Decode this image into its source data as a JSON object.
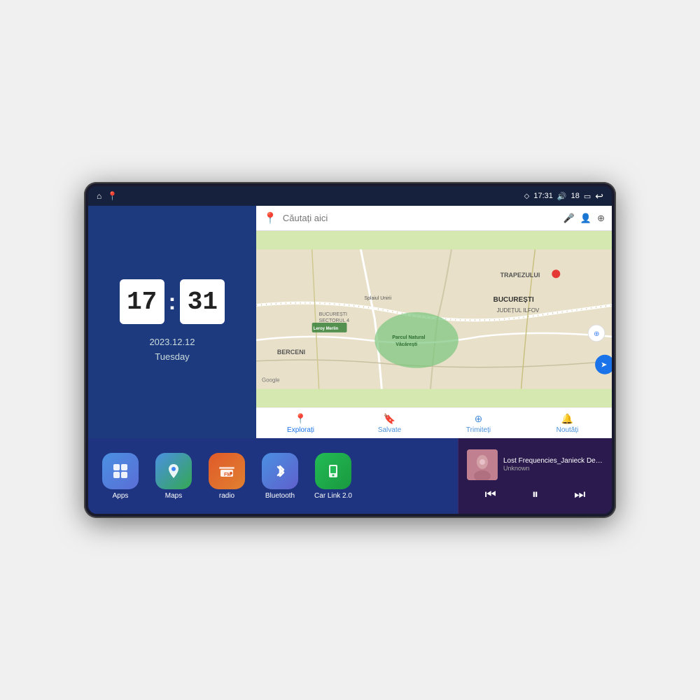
{
  "device": {
    "screen": {
      "status_bar": {
        "left_icons": [
          "home",
          "location"
        ],
        "time": "17:31",
        "volume_icon": "🔊",
        "battery_level": "18",
        "battery_icon": "🔋",
        "back_icon": "↩"
      },
      "clock": {
        "hours": "17",
        "minutes": "31",
        "date": "2023.12.12",
        "day": "Tuesday"
      },
      "map": {
        "search_placeholder": "Căutați aici",
        "location_label": "TRAPEZULUI",
        "city_label": "BUCUREȘTI",
        "region_label": "JUDEȚUL ILFOV",
        "area_label": "BERCENI",
        "park_label": "Parcul Natural Văcărești",
        "store_label": "Leroy Merlin",
        "district_label": "BUCUREȘTI SECTORUL 4",
        "road_label": "Splaiul Unirii",
        "google_label": "Google",
        "nav_items": [
          {
            "label": "Explorați",
            "icon": "📍",
            "active": true
          },
          {
            "label": "Salvate",
            "icon": "🔖",
            "active": false
          },
          {
            "label": "Trimiteți",
            "icon": "⊕",
            "active": false
          },
          {
            "label": "Noutăți",
            "icon": "🔔",
            "active": false
          }
        ]
      },
      "apps": [
        {
          "label": "Apps",
          "icon_class": "apps-icon",
          "icon_char": "⊞"
        },
        {
          "label": "Maps",
          "icon_class": "maps-icon",
          "icon_char": "📍"
        },
        {
          "label": "radio",
          "icon_class": "radio-icon",
          "icon_char": "📻"
        },
        {
          "label": "Bluetooth",
          "icon_class": "bluetooth-icon",
          "icon_char": "⦿"
        },
        {
          "label": "Car Link 2.0",
          "icon_class": "carlink-icon",
          "icon_char": "📱"
        }
      ],
      "music": {
        "title": "Lost Frequencies_Janieck Devy-...",
        "artist": "Unknown",
        "controls": {
          "prev": "⏮",
          "play_pause": "⏸",
          "next": "⏭"
        }
      }
    }
  }
}
